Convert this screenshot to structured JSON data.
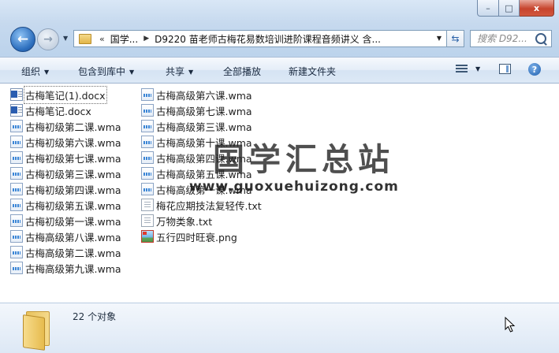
{
  "window": {
    "caption_buttons": {
      "minimize": "–",
      "maximize": "□",
      "close": "x"
    }
  },
  "nav": {
    "back_glyph": "←",
    "forward_glyph": "→",
    "address": {
      "overflow": "«",
      "segments": [
        "国学...",
        "D9220 苗老师古梅花易数培训进阶课程音频讲义 含..."
      ]
    },
    "search_placeholder": "搜索 D92..."
  },
  "toolbar": {
    "organize": "组织",
    "include_in_library": "包含到库中",
    "share": "共享",
    "play_all": "全部播放",
    "new_folder": "新建文件夹",
    "help": "?"
  },
  "files": {
    "column1": [
      {
        "name": "古梅笔记(1).docx",
        "icon": "word-doc-icon",
        "type": "doc"
      },
      {
        "name": "古梅笔记.docx",
        "icon": "word-doc-icon",
        "type": "doc"
      },
      {
        "name": "古梅初级第二课.wma",
        "icon": "wma-audio-icon",
        "type": "wma"
      },
      {
        "name": "古梅初级第六课.wma",
        "icon": "wma-audio-icon",
        "type": "wma"
      },
      {
        "name": "古梅初级第七课.wma",
        "icon": "wma-audio-icon",
        "type": "wma"
      },
      {
        "name": "古梅初级第三课.wma",
        "icon": "wma-audio-icon",
        "type": "wma"
      },
      {
        "name": "古梅初级第四课.wma",
        "icon": "wma-audio-icon",
        "type": "wma"
      },
      {
        "name": "古梅初级第五课.wma",
        "icon": "wma-audio-icon",
        "type": "wma"
      },
      {
        "name": "古梅初级第一课.wma",
        "icon": "wma-audio-icon",
        "type": "wma"
      },
      {
        "name": "古梅高级第八课.wma",
        "icon": "wma-audio-icon",
        "type": "wma"
      },
      {
        "name": "古梅高级第二课.wma",
        "icon": "wma-audio-icon",
        "type": "wma"
      },
      {
        "name": "古梅高级第九课.wma",
        "icon": "wma-audio-icon",
        "type": "wma"
      }
    ],
    "column2": [
      {
        "name": "古梅高级第六课.wma",
        "icon": "wma-audio-icon",
        "type": "wma"
      },
      {
        "name": "古梅高级第七课.wma",
        "icon": "wma-audio-icon",
        "type": "wma"
      },
      {
        "name": "古梅高级第三课.wma",
        "icon": "wma-audio-icon",
        "type": "wma"
      },
      {
        "name": "古梅高级第十课.wma",
        "icon": "wma-audio-icon",
        "type": "wma"
      },
      {
        "name": "古梅高级第四课.wma",
        "icon": "wma-audio-icon",
        "type": "wma"
      },
      {
        "name": "古梅高级第五课.wma",
        "icon": "wma-audio-icon",
        "type": "wma"
      },
      {
        "name": "古梅高级第一课.wma",
        "icon": "wma-audio-icon",
        "type": "wma"
      },
      {
        "name": "梅花应期技法复轻传.txt",
        "icon": "text-file-icon",
        "type": "txt"
      },
      {
        "name": "万物类象.txt",
        "icon": "text-file-icon",
        "type": "txt"
      },
      {
        "name": "五行四时旺衰.png",
        "icon": "png-image-icon",
        "type": "png"
      }
    ]
  },
  "watermark": {
    "title": "国学汇总站",
    "url": "www.guoxuehuizong.com"
  },
  "details": {
    "count_text": "22 个对象"
  }
}
